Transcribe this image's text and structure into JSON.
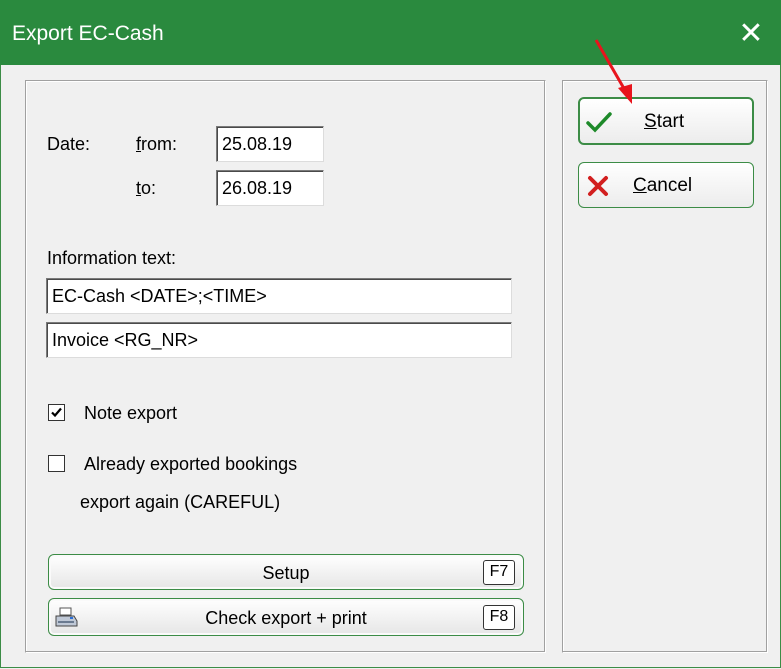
{
  "window": {
    "title": "Export EC-Cash",
    "close_glyph": "✕"
  },
  "date": {
    "label": "Date:",
    "from_label_ul": "f",
    "from_label_rest": "rom:",
    "from_value": "25.08.19",
    "to_label_ul": "t",
    "to_label_rest": "o:",
    "to_value": "26.08.19"
  },
  "info": {
    "label": "Information text:",
    "line1": "EC-Cash <DATE>;<TIME>",
    "line2": "Invoice <RG_NR>"
  },
  "options": {
    "note_export": {
      "label": "Note export",
      "checked": true
    },
    "already_exported": {
      "label_line1": "Already exported bookings",
      "label_line2": "export again (CAREFUL)",
      "checked": false
    }
  },
  "buttons": {
    "setup": {
      "label": "Setup",
      "key": "F7"
    },
    "check_export": {
      "label": "Check export + print",
      "key": "F8",
      "icon": "printer-icon"
    },
    "start": {
      "label_ul": "S",
      "label_rest": "tart",
      "icon": "checkmark-icon"
    },
    "cancel": {
      "label_ul": "C",
      "label_rest": "ancel",
      "icon": "x-cross-icon"
    }
  },
  "colors": {
    "titlebar": "#2a8a3e",
    "button_border": "#3c8c46",
    "annotation_arrow": "#e8141c"
  }
}
